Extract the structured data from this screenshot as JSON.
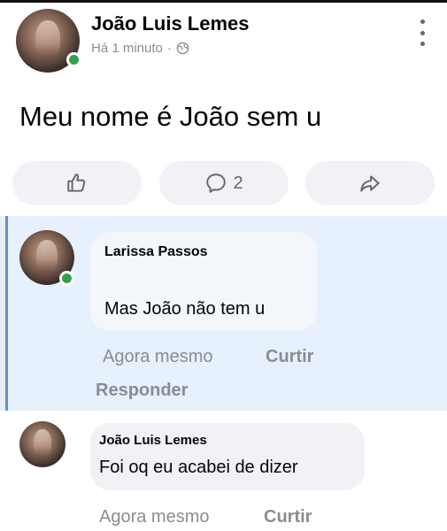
{
  "post": {
    "author": "João Luis Lemes",
    "time": "Há 1 minuto",
    "separator": "·",
    "text": "Meu nome é João sem u",
    "comment_count": "2"
  },
  "icons": {
    "globe": "globe-icon",
    "more": "more-options-icon",
    "like": "like-thumb-icon",
    "comment": "comment-bubble-icon",
    "share": "share-arrow-icon"
  },
  "comments": [
    {
      "author": "Larissa Passos",
      "text": "Mas João não tem u",
      "time": "Agora mesmo",
      "like": "Curtir",
      "reply": "Responder"
    },
    {
      "author": "João Luis Lemes",
      "text": "Foi oq eu acabei de dizer",
      "time": "Agora mesmo",
      "like": "Curtir"
    }
  ],
  "colors": {
    "online": "#31a24c",
    "highlight": "#e7f0fd",
    "secondary_text": "#8a8d91",
    "pill_bg": "#f0f2f5"
  }
}
